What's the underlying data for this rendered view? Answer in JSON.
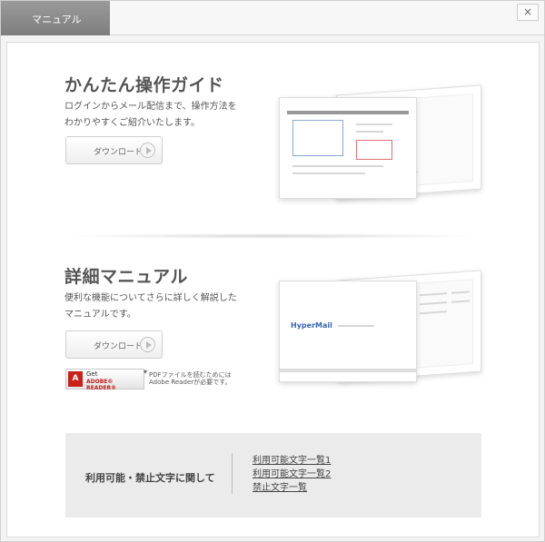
{
  "window": {
    "tab_label": "マニュアル",
    "close_symbol": "×"
  },
  "guide": {
    "title": "かんたん操作ガイド",
    "description": "ログインからメール配信まで、操作方法を\nわかりやすくご紹介いたします。",
    "download_label": "ダウンロード"
  },
  "manual": {
    "title": "詳細マニュアル",
    "description": "便利な機能についてさらに詳しく解説した\nマニュアルです。",
    "download_label": "ダウンロード",
    "thumb_logo": "HyperMail"
  },
  "adobe": {
    "get_label": "Get",
    "reader_label": "ADOBE® READER®",
    "note": "PDFファイルを読むためには\nAdobe Readerが必要です。"
  },
  "bottom": {
    "title": "利用可能・禁止文字に関して",
    "links": [
      "利用可能文字一覧1",
      "利用可能文字一覧2",
      "禁止文字一覧"
    ]
  }
}
